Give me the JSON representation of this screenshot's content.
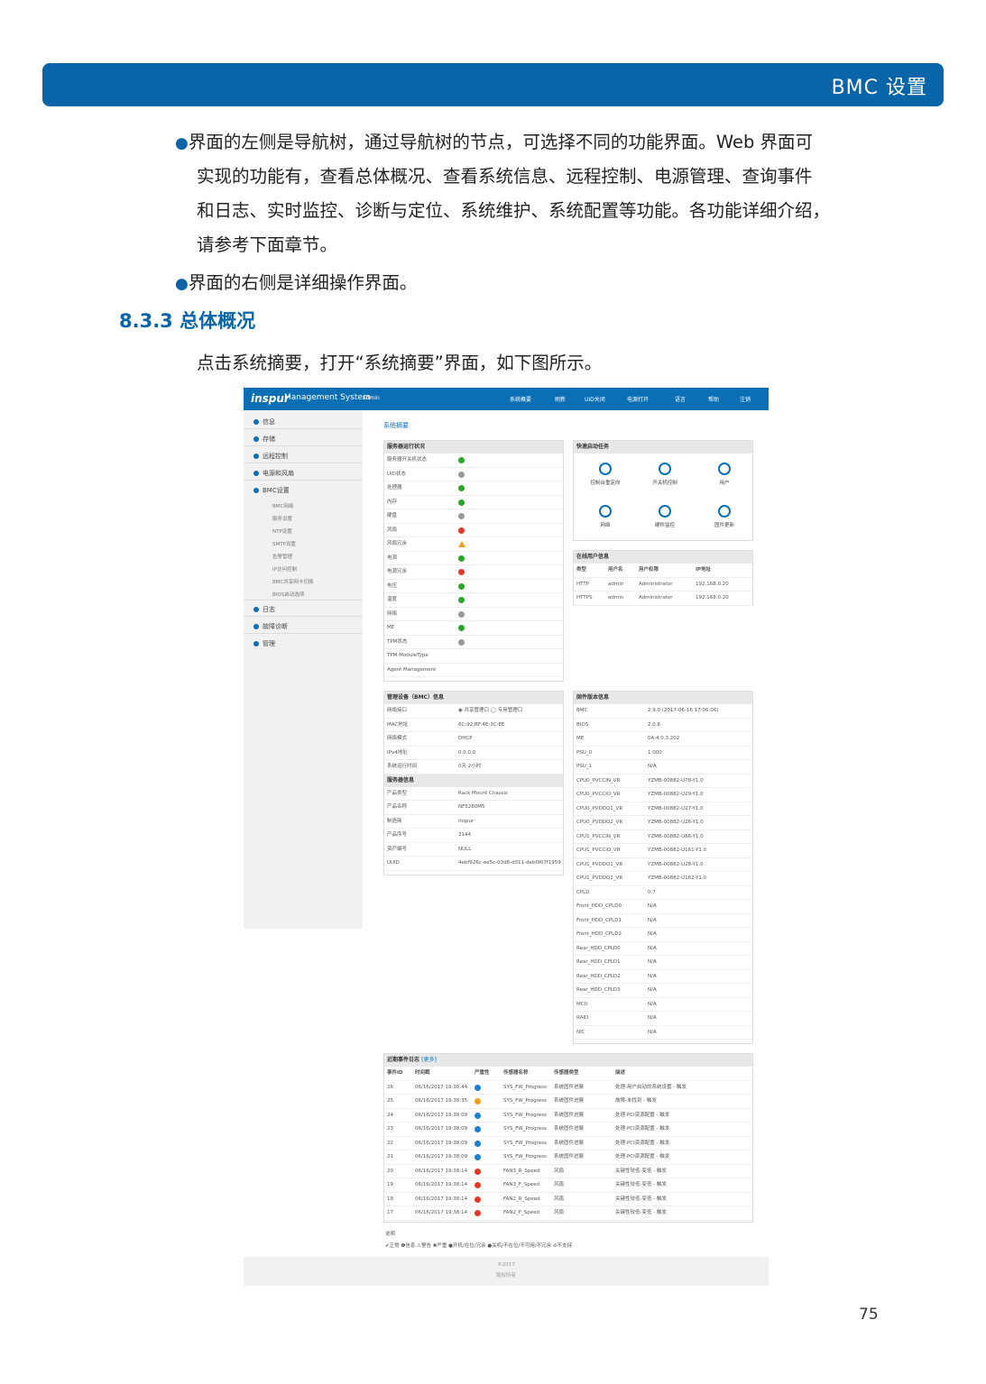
{
  "header": {
    "title": "BMC 设置"
  },
  "bullets": [
    {
      "lines": [
        "界面的左侧是导航树，通过导航树的节点，可选择不同的功能界面。Web 界面可",
        "实现的功能有，查看总体概况、查看系统信息、远程控制、电源管理、查询事件",
        "和日志、实时监控、诊断与定位、系统维护、系统配置等功能。各功能详细介绍，",
        "请参考下面章节。"
      ]
    },
    {
      "lines": [
        "界面的右侧是详细操作界面。"
      ]
    }
  ],
  "bullet_symbol": "●",
  "section": {
    "title": "8.3.3 总体概况"
  },
  "intro": "点击系统摘要，打开“系统摘要”界面，如下图所示。",
  "page_number": "75",
  "shot": {
    "logo": "inspur",
    "app": "Management System",
    "user": "admin",
    "nav": [
      "系统概要",
      "刷新",
      "UID关闭",
      "电源打开",
      "语言",
      "帮助",
      "注销"
    ],
    "side_main": [
      "信息",
      "存储",
      "远程控制",
      "电源和风扇",
      "BMC设置"
    ],
    "side_sub": [
      "BMC网络",
      "服务设置",
      "NTP设置",
      "SMTP设置",
      "告警管理",
      "IP访问控制",
      "BMC共享网卡切换",
      "BIOS启动选项"
    ],
    "side_bottom": [
      "日志",
      "故障诊断",
      "管理"
    ],
    "crumb": "系统摘要",
    "status": {
      "title": "服务器运行状况",
      "rows": [
        [
          "服务器开关机状态",
          "ok"
        ],
        [
          "UID状态",
          "gray"
        ],
        [
          "处理器",
          "ok"
        ],
        [
          "内存",
          "ok"
        ],
        [
          "硬盘",
          "gray"
        ],
        [
          "风扇",
          "err"
        ],
        [
          "风扇冗余",
          "warn"
        ],
        [
          "电源",
          "ok"
        ],
        [
          "电源冗余",
          "err"
        ],
        [
          "电压",
          "ok"
        ],
        [
          "温度",
          "ok"
        ],
        [
          "网络",
          "gray"
        ],
        [
          "ME",
          "ok"
        ],
        [
          "TPM状态",
          "gray"
        ],
        [
          "TPM ModuleType",
          ""
        ],
        [
          "Agent Management",
          ""
        ]
      ]
    },
    "quick": {
      "title": "快速启动任务",
      "items": [
        "控制台重定向",
        "开关机控制",
        "用户",
        "网络",
        "硬件监控",
        "固件更新"
      ]
    },
    "online": {
      "title": "在线用户信息",
      "head": [
        "类型",
        "用户名",
        "用户权限",
        "IP地址"
      ],
      "rows": [
        [
          "HTTP",
          "admin",
          "Administrator",
          "192.168.0.20"
        ],
        [
          "HTTPS",
          "admin",
          "Administrator",
          "192.168.0.20"
        ]
      ]
    },
    "bmc": {
      "title": "管理设备（BMC）信息",
      "rows": [
        [
          "网络接口",
          "◉ 共享管理口   ◯ 专用管理口"
        ],
        [
          "MAC地址",
          "6C:92:BF:4E:3C:EE"
        ],
        [
          "网络模式",
          "DHCP"
        ],
        [
          "IPv4地址",
          "0.0.0.0"
        ],
        [
          "系统运行时间",
          "0天 2小时"
        ]
      ],
      "title2": "服务器信息",
      "rows2": [
        [
          "产品类型",
          "Rack Mount Chassis"
        ],
        [
          "产品名称",
          "NF5280M5"
        ],
        [
          "制造商",
          "Inspur"
        ],
        [
          "产品序号",
          "3144"
        ],
        [
          "资产编号",
          "NULL"
        ],
        [
          "UUID",
          "4ebf926c-ee5c-03d6-d311-debf907f1959"
        ]
      ]
    },
    "fw": {
      "title": "固件版本信息",
      "rows": [
        [
          "BMC",
          "2.9.0 (2017-06-16 17:06:06)"
        ],
        [
          "BIOS",
          "2.0.6"
        ],
        [
          "ME",
          "0A:4.0.3.202"
        ],
        [
          "PSU_0",
          "1.000"
        ],
        [
          "PSU_1",
          "N/A"
        ],
        [
          "CPU0_PVCCIN_VR",
          "YZMB-00882-U78-Y1.0"
        ],
        [
          "CPU0_PVCCIO_VR",
          "YZMB-00882-U29-Y1.0"
        ],
        [
          "CPU0_PVDDQ1_VR",
          "YZMB-00882-U27-Y1.0"
        ],
        [
          "CPU0_PVDDQ2_VR",
          "YZMB-00882-U26-Y1.0"
        ],
        [
          "CPU1_PVCCIN_VR",
          "YZMB-00882-U86-Y1.0"
        ],
        [
          "CPU1_PVCCIO_VR",
          "YZMB-00882-U161-Y1.0"
        ],
        [
          "CPU1_PVDDQ1_VR",
          "YZMB-00882-U28-Y1.0"
        ],
        [
          "CPU1_PVDDQ2_VR",
          "YZMB-00882-U162-Y1.0"
        ],
        [
          "CPLD",
          "0.7"
        ],
        [
          "Front_HDD_CPLD0",
          "N/A"
        ],
        [
          "Front_HDD_CPLD1",
          "N/A"
        ],
        [
          "Front_HDD_CPLD2",
          "N/A"
        ],
        [
          "Rear_HDD_CPLD0",
          "N/A"
        ],
        [
          "Rear_HDD_CPLD1",
          "N/A"
        ],
        [
          "Rear_HDD_CPLD2",
          "N/A"
        ],
        [
          "Rear_HDD_CPLD3",
          "N/A"
        ],
        [
          "MCU",
          "N/A"
        ],
        [
          "RAID",
          "N/A"
        ],
        [
          "NIC",
          "N/A"
        ]
      ]
    },
    "events": {
      "title": "近期事件日志",
      "more": "[更多]",
      "head": [
        "事件ID",
        "时间戳",
        "严重性",
        "传感器名称",
        "传感器类型",
        "描述"
      ],
      "rows": [
        [
          "26",
          "06/16/2017 19:38:44",
          "info",
          "SYS_FW_Progress",
          "系统固件进展",
          "处理-用户启动的系统设置 - 触发"
        ],
        [
          "25",
          "06/16/2017 19:38:35",
          "warn",
          "SYS_FW_Progress",
          "系统固件进展",
          "故障-未找到 - 触发"
        ],
        [
          "24",
          "06/16/2017 19:38:09",
          "info",
          "SYS_FW_Progress",
          "系统固件进展",
          "处理-PCI资源配置 - 触发"
        ],
        [
          "23",
          "06/16/2017 19:38:09",
          "info",
          "SYS_FW_Progress",
          "系统固件进展",
          "处理-PCI资源配置 - 触发"
        ],
        [
          "22",
          "06/16/2017 19:38:09",
          "info",
          "SYS_FW_Progress",
          "系统固件进展",
          "处理-PCI资源配置 - 触发"
        ],
        [
          "21",
          "06/16/2017 19:38:09",
          "info",
          "SYS_FW_Progress",
          "系统固件进展",
          "处理-PCI资源配置 - 触发"
        ],
        [
          "20",
          "06/16/2017 19:38:14",
          "err",
          "FAN3_R_Speed",
          "风扇",
          "关键性较低-变低 - 触发"
        ],
        [
          "19",
          "06/16/2017 19:38:14",
          "err",
          "FAN3_F_Speed",
          "风扇",
          "关键性较低-变低 - 触发"
        ],
        [
          "18",
          "06/16/2017 19:38:14",
          "err",
          "FAN2_R_Speed",
          "风扇",
          "关键性较低-变低 - 触发"
        ],
        [
          "17",
          "06/16/2017 19:38:14",
          "err",
          "FAN2_F_Speed",
          "风扇",
          "关键性较低-变低 - 触发"
        ]
      ]
    },
    "legend_title": "说明",
    "legend": "✔正常 ❶信息 ⚠警告 ✖严重 ●开机/在位/冗余 ●关机/不在位/不可用/不冗余 ⊘不支持",
    "foot1": "©2017",
    "foot2": "版权所有",
    "colors": {
      "ok": "#2aa52a",
      "gray": "#999999",
      "err": "#e23a2a",
      "warn": "#f0a020",
      "info": "#1e7fd0"
    }
  }
}
